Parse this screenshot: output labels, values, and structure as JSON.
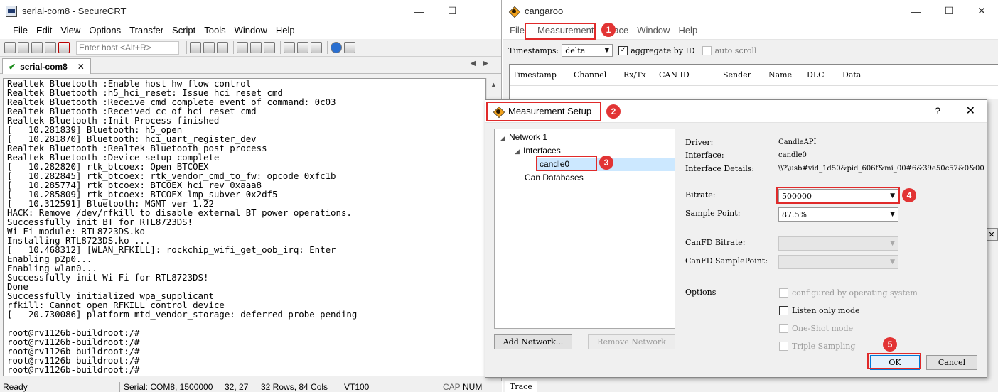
{
  "crt": {
    "title": "serial-com8 - SecureCRT",
    "menu": [
      "File",
      "Edit",
      "View",
      "Options",
      "Transfer",
      "Script",
      "Tools",
      "Window",
      "Help"
    ],
    "host_placeholder": "Enter host <Alt+R>",
    "tab_label": "serial-com8",
    "terminal_lines": [
      "Realtek Bluetooth :Enable host hw flow control",
      "Realtek Bluetooth :h5_hci_reset: Issue hci reset cmd",
      "Realtek Bluetooth :Receive cmd complete event of command: 0c03",
      "Realtek Bluetooth :Received cc of hci reset cmd",
      "Realtek Bluetooth :Init Process finished",
      "[   10.281839] Bluetooth: h5_open",
      "[   10.281870] Bluetooth: hci_uart_register_dev",
      "Realtek Bluetooth :Realtek Bluetooth post process",
      "Realtek Bluetooth :Device setup complete",
      "[   10.282820] rtk_btcoex: Open BTCOEX",
      "[   10.282845] rtk_btcoex: rtk_vendor_cmd_to_fw: opcode 0xfc1b",
      "[   10.285774] rtk_btcoex: BTCOEX hci_rev 0xaaa8",
      "[   10.285809] rtk_btcoex: BTCOEX lmp_subver 0x2df5",
      "[   10.312591] Bluetooth: MGMT ver 1.22",
      "HACK: Remove /dev/rfkill to disable external BT power operations.",
      "Successfully init BT for RTL8723DS!",
      "Wi-Fi module: RTL8723DS.ko",
      "Installing RTL8723DS.ko ...",
      "[   10.468312] [WLAN_RFKILL]: rockchip_wifi_get_oob_irq: Enter",
      "Enabling p2p0...",
      "Enabling wlan0...",
      "Successfully init Wi-Fi for RTL8723DS!",
      "Done",
      "Successfully initialized wpa_supplicant",
      "rfkill: Cannot open RFKILL control device",
      "[   20.730086] platform mtd_vendor_storage: deferred probe pending",
      "",
      "root@rv1126b-buildroot:/#",
      "root@rv1126b-buildroot:/#",
      "root@rv1126b-buildroot:/#",
      "root@rv1126b-buildroot:/#",
      "root@rv1126b-buildroot:/#"
    ],
    "status": {
      "ready": "Ready",
      "serial": "Serial: COM8, 1500000",
      "cursor": "32,  27",
      "size": "32 Rows, 84 Cols",
      "emulation": "VT100",
      "cap": "CAP",
      "num": "NUM"
    }
  },
  "cangaroo": {
    "title": "cangaroo",
    "menu": [
      "File",
      "Measurement",
      "Trace",
      "Window",
      "Help"
    ],
    "timestamps_label": "Timestamps:",
    "timestamps_value": "delta",
    "aggregate_label": "aggregate by ID",
    "aggregate_checked": true,
    "autoscroll_label": "auto scroll",
    "columns": [
      "Timestamp",
      "Channel",
      "Rx/Tx",
      "CAN ID",
      "Sender",
      "Name",
      "DLC",
      "Data"
    ],
    "bottom_tab": "Trace"
  },
  "dialog": {
    "title": "Measurement Setup",
    "help": "?",
    "tree": {
      "network": "Network 1",
      "interfaces": "Interfaces",
      "candle": "candle0",
      "databases": "Can Databases"
    },
    "add_network": "Add Network...",
    "remove_network": "Remove Network",
    "driver_label": "Driver:",
    "driver_value": "CandleAPI",
    "interface_label": "Interface:",
    "interface_value": "candle0",
    "details_label": "Interface Details:",
    "details_value": "\\\\?\\usb#vid_1d50&pid_606f&mi_00#6&39e50c57&0&00",
    "bitrate_label": "Bitrate:",
    "bitrate_value": "500000",
    "sample_point_label": "Sample Point:",
    "sample_point_value": "87.5%",
    "canfd_bitrate_label": "CanFD Bitrate:",
    "canfd_sample_label": "CanFD SamplePoint:",
    "options_label": "Options",
    "opt_configured": "configured by operating system",
    "opt_listen": "Listen only mode",
    "opt_oneshot": "One-Shot mode",
    "opt_triple": "Triple Sampling",
    "ok": "OK",
    "cancel": "Cancel"
  },
  "markers": [
    "1",
    "2",
    "3",
    "4",
    "5"
  ],
  "colors": {
    "highlight": "#e02a2a",
    "selection": "#cce8ff"
  }
}
